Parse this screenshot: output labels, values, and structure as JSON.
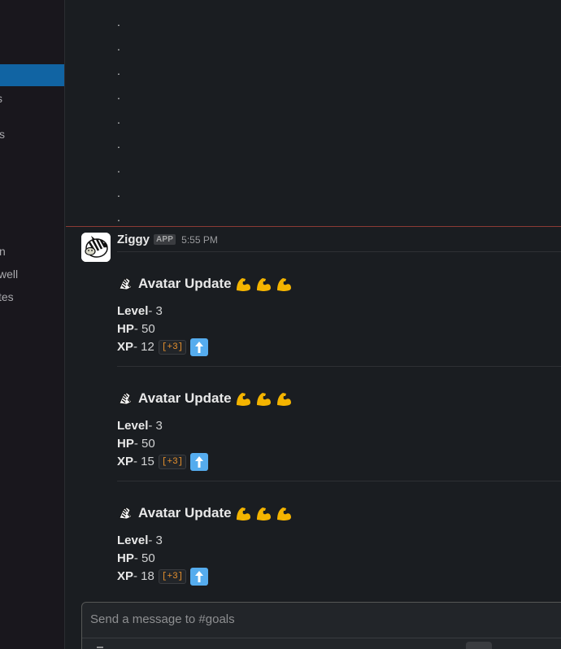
{
  "sidebar": {
    "items": [
      {
        "label": ""
      },
      {
        "label": "s"
      },
      {
        "label": "s"
      },
      {
        "label": "n"
      },
      {
        "label": "well"
      },
      {
        "label": "tes"
      }
    ]
  },
  "message": {
    "sender": "Ziggy",
    "badge": "APP",
    "time": "5:55 PM"
  },
  "updates": [
    {
      "title": "Avatar Update",
      "level_label": "Level",
      "level": " - 3",
      "hp_label": "HP",
      "hp": " - 50",
      "xp_label": "XP",
      "xp": " - 12",
      "xp_delta": "[+3]"
    },
    {
      "title": "Avatar Update",
      "level_label": "Level",
      "level": " - 3",
      "hp_label": "HP",
      "hp": " - 50",
      "xp_label": "XP",
      "xp": " - 15",
      "xp_delta": "[+3]"
    },
    {
      "title": "Avatar Update",
      "level_label": "Level",
      "level": " - 3",
      "hp_label": "HP",
      "hp": " - 50",
      "xp_label": "XP",
      "xp": " - 18",
      "xp_delta": "[+3]"
    }
  ],
  "dots": [
    ".",
    ".",
    ".",
    ".",
    ".",
    ".",
    ".",
    ".",
    "."
  ],
  "composer": {
    "placeholder": "Send a message to #goals"
  },
  "colors": {
    "accent": "#1164a3",
    "unread_divider": "#8b3a34",
    "xp_code": "#e8912d"
  }
}
